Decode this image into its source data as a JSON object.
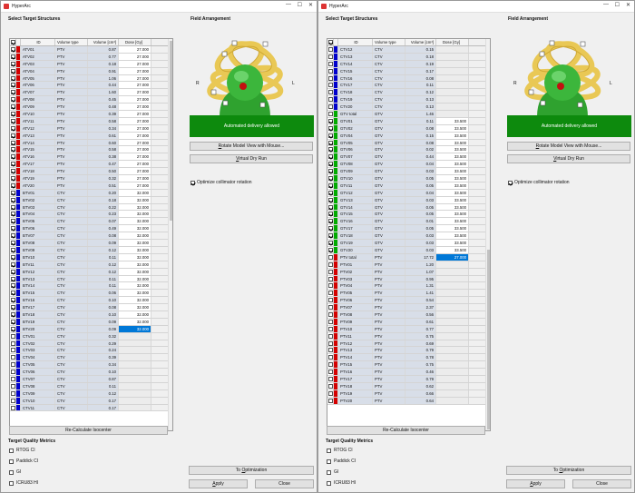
{
  "windows": [
    {
      "title": "HyperArc",
      "select_title": "Select Target Structures",
      "headers": {
        "id": "ID",
        "volume_type": "Volume type",
        "volume": "Volume [cm³]",
        "dose": "Dose [Gy]"
      },
      "rows": [
        {
          "c": 1,
          "color": "#d40000",
          "id": "ATV01",
          "vt": "PTV",
          "vol": "0.87",
          "dose": "27.000"
        },
        {
          "c": 1,
          "color": "#d40000",
          "id": "ATV02",
          "vt": "PTV",
          "vol": "0.77",
          "dose": "27.000"
        },
        {
          "c": 1,
          "color": "#d40000",
          "id": "ATV03",
          "vt": "PTV",
          "vol": "0.18",
          "dose": "27.000"
        },
        {
          "c": 1,
          "color": "#d40000",
          "id": "ATV04",
          "vt": "PTV",
          "vol": "0.91",
          "dose": "27.000"
        },
        {
          "c": 1,
          "color": "#d40000",
          "id": "ATV05",
          "vt": "PTV",
          "vol": "1.06",
          "dose": "27.000"
        },
        {
          "c": 1,
          "color": "#d40000",
          "id": "ATV06",
          "vt": "PTV",
          "vol": "0.44",
          "dose": "27.000"
        },
        {
          "c": 1,
          "color": "#d40000",
          "id": "ATV07",
          "vt": "PTV",
          "vol": "1.60",
          "dose": "27.000"
        },
        {
          "c": 1,
          "color": "#d40000",
          "id": "ATV08",
          "vt": "PTV",
          "vol": "0.45",
          "dose": "27.000"
        },
        {
          "c": 1,
          "color": "#d40000",
          "id": "ATV09",
          "vt": "PTV",
          "vol": "0.48",
          "dose": "27.000"
        },
        {
          "c": 1,
          "color": "#d40000",
          "id": "ATV10",
          "vt": "PTV",
          "vol": "0.39",
          "dose": "27.000"
        },
        {
          "c": 1,
          "color": "#d40000",
          "id": "ATV11",
          "vt": "PTV",
          "vol": "0.58",
          "dose": "27.000"
        },
        {
          "c": 1,
          "color": "#d40000",
          "id": "ATV12",
          "vt": "PTV",
          "vol": "0.34",
          "dose": "27.000"
        },
        {
          "c": 1,
          "color": "#d40000",
          "id": "ATV13",
          "vt": "PTV",
          "vol": "0.61",
          "dose": "27.000"
        },
        {
          "c": 1,
          "color": "#d40000",
          "id": "ATV14",
          "vt": "PTV",
          "vol": "0.60",
          "dose": "27.000"
        },
        {
          "c": 1,
          "color": "#d40000",
          "id": "ATV15",
          "vt": "PTV",
          "vol": "0.58",
          "dose": "27.000"
        },
        {
          "c": 1,
          "color": "#d40000",
          "id": "ATV16",
          "vt": "PTV",
          "vol": "0.38",
          "dose": "27.000"
        },
        {
          "c": 1,
          "color": "#d40000",
          "id": "ATV17",
          "vt": "PTV",
          "vol": "0.47",
          "dose": "27.000"
        },
        {
          "c": 1,
          "color": "#d40000",
          "id": "ATV18",
          "vt": "PTV",
          "vol": "0.50",
          "dose": "27.000"
        },
        {
          "c": 1,
          "color": "#d40000",
          "id": "ATV19",
          "vt": "PTV",
          "vol": "0.32",
          "dose": "27.000"
        },
        {
          "c": 1,
          "color": "#d40000",
          "id": "ATV20",
          "vt": "PTV",
          "vol": "0.51",
          "dose": "27.000"
        },
        {
          "c": 1,
          "color": "#0000cc",
          "id": "BTV01",
          "vt": "CTV",
          "vol": "0.20",
          "dose": "32.000"
        },
        {
          "c": 1,
          "color": "#0000cc",
          "id": "BTV02",
          "vt": "CTV",
          "vol": "0.18",
          "dose": "32.000"
        },
        {
          "c": 1,
          "color": "#0000cc",
          "id": "BTV03",
          "vt": "CTV",
          "vol": "0.22",
          "dose": "32.000"
        },
        {
          "c": 1,
          "color": "#0000cc",
          "id": "BTV04",
          "vt": "CTV",
          "vol": "0.23",
          "dose": "32.000"
        },
        {
          "c": 1,
          "color": "#0000cc",
          "id": "BTV05",
          "vt": "CTV",
          "vol": "0.07",
          "dose": "32.000"
        },
        {
          "c": 1,
          "color": "#0000cc",
          "id": "BTV06",
          "vt": "CTV",
          "vol": "0.49",
          "dose": "32.000"
        },
        {
          "c": 1,
          "color": "#0000cc",
          "id": "BTV07",
          "vt": "CTV",
          "vol": "0.08",
          "dose": "32.000"
        },
        {
          "c": 1,
          "color": "#0000cc",
          "id": "BTV08",
          "vt": "CTV",
          "vol": "0.09",
          "dose": "32.000"
        },
        {
          "c": 1,
          "color": "#0000cc",
          "id": "BTV09",
          "vt": "CTV",
          "vol": "0.12",
          "dose": "32.000"
        },
        {
          "c": 1,
          "color": "#0000cc",
          "id": "BTV10",
          "vt": "CTV",
          "vol": "0.11",
          "dose": "32.000"
        },
        {
          "c": 1,
          "color": "#0000cc",
          "id": "BTV11",
          "vt": "CTV",
          "vol": "0.12",
          "dose": "32.000"
        },
        {
          "c": 1,
          "color": "#0000cc",
          "id": "BTV12",
          "vt": "CTV",
          "vol": "0.12",
          "dose": "32.000"
        },
        {
          "c": 1,
          "color": "#0000cc",
          "id": "BTV13",
          "vt": "CTV",
          "vol": "0.11",
          "dose": "32.000"
        },
        {
          "c": 1,
          "color": "#0000cc",
          "id": "BTV14",
          "vt": "CTV",
          "vol": "0.11",
          "dose": "32.000"
        },
        {
          "c": 1,
          "color": "#0000cc",
          "id": "BTV15",
          "vt": "CTV",
          "vol": "0.06",
          "dose": "32.000"
        },
        {
          "c": 1,
          "color": "#0000cc",
          "id": "BTV16",
          "vt": "CTV",
          "vol": "0.10",
          "dose": "32.000"
        },
        {
          "c": 1,
          "color": "#0000cc",
          "id": "BTV17",
          "vt": "CTV",
          "vol": "0.08",
          "dose": "32.000"
        },
        {
          "c": 1,
          "color": "#0000cc",
          "id": "BTV18",
          "vt": "CTV",
          "vol": "0.10",
          "dose": "32.000"
        },
        {
          "c": 1,
          "color": "#0000cc",
          "id": "BTV19",
          "vt": "CTV",
          "vol": "0.09",
          "dose": "32.000"
        },
        {
          "c": 1,
          "color": "#0000cc",
          "id": "BTV20",
          "vt": "CTV",
          "vol": "0.09",
          "dose": "32.000",
          "sel": 1
        },
        {
          "c": 0,
          "color": "#0000cc",
          "id": "CTV01",
          "vt": "CTV",
          "vol": "0.32",
          "dose": ""
        },
        {
          "c": 0,
          "color": "#0000cc",
          "id": "CTV02",
          "vt": "CTV",
          "vol": "0.29",
          "dose": ""
        },
        {
          "c": 0,
          "color": "#0000cc",
          "id": "CTV03",
          "vt": "CTV",
          "vol": "0.24",
          "dose": ""
        },
        {
          "c": 0,
          "color": "#0000cc",
          "id": "CTV04",
          "vt": "CTV",
          "vol": "0.39",
          "dose": ""
        },
        {
          "c": 0,
          "color": "#0000cc",
          "id": "CTV05",
          "vt": "CTV",
          "vol": "0.34",
          "dose": ""
        },
        {
          "c": 0,
          "color": "#0000cc",
          "id": "CTV06",
          "vt": "CTV",
          "vol": "0.10",
          "dose": ""
        },
        {
          "c": 0,
          "color": "#0000cc",
          "id": "CTV07",
          "vt": "CTV",
          "vol": "0.87",
          "dose": ""
        },
        {
          "c": 0,
          "color": "#0000cc",
          "id": "CTV08",
          "vt": "CTV",
          "vol": "0.11",
          "dose": ""
        },
        {
          "c": 0,
          "color": "#0000cc",
          "id": "CTV09",
          "vt": "CTV",
          "vol": "0.12",
          "dose": ""
        },
        {
          "c": 0,
          "color": "#0000cc",
          "id": "CTV10",
          "vt": "CTV",
          "vol": "0.17",
          "dose": ""
        },
        {
          "c": 0,
          "color": "#0000cc",
          "id": "CTV11",
          "vt": "CTV",
          "vol": "0.17",
          "dose": ""
        }
      ],
      "recalc": "Re-Calculate Isocenter",
      "quality_title": "Target Quality Metrics",
      "metrics": [
        "RTOG CI",
        "Paddick CI",
        "GI",
        "ICRU83 HI"
      ],
      "field_title": "Field Arrangement",
      "status": "Automated delivery allowed",
      "status_color": "#0d8a0d",
      "rotate": "Rotate Model View with Mouse...",
      "virtual": "Virtual Dry Run",
      "optimize": "Optimize collimator rotation",
      "to_opt": "To Optimization",
      "apply": "Apply",
      "close": "Close",
      "lbl_r": "R",
      "lbl_l": "L"
    },
    {
      "title": "HyperArc",
      "select_title": "Select Target Structures",
      "headers": {
        "id": "ID",
        "volume_type": "Volume type",
        "volume": "Volume [cm³]",
        "dose": "Dose [Gy]"
      },
      "rows": [
        {
          "c": 0,
          "color": "#0000cc",
          "id": "CTV12",
          "vt": "CTV",
          "vol": "0.15",
          "dose": ""
        },
        {
          "c": 0,
          "color": "#0000cc",
          "id": "CTV13",
          "vt": "CTV",
          "vol": "0.18",
          "dose": ""
        },
        {
          "c": 0,
          "color": "#0000cc",
          "id": "CTV14",
          "vt": "CTV",
          "vol": "0.19",
          "dose": ""
        },
        {
          "c": 0,
          "color": "#0000cc",
          "id": "CTV15",
          "vt": "CTV",
          "vol": "0.17",
          "dose": ""
        },
        {
          "c": 0,
          "color": "#0000cc",
          "id": "CTV16",
          "vt": "CTV",
          "vol": "0.08",
          "dose": ""
        },
        {
          "c": 0,
          "color": "#0000cc",
          "id": "CTV17",
          "vt": "CTV",
          "vol": "0.11",
          "dose": ""
        },
        {
          "c": 0,
          "color": "#0000cc",
          "id": "CTV18",
          "vt": "CTV",
          "vol": "0.12",
          "dose": ""
        },
        {
          "c": 0,
          "color": "#0000cc",
          "id": "CTV19",
          "vt": "CTV",
          "vol": "0.13",
          "dose": ""
        },
        {
          "c": 0,
          "color": "#0000cc",
          "id": "CTV20",
          "vt": "CTV",
          "vol": "0.13",
          "dose": ""
        },
        {
          "c": 0,
          "color": "#00aa00",
          "id": "GTV total",
          "vt": "GTV",
          "vol": "1.46",
          "dose": ""
        },
        {
          "c": 1,
          "color": "#00aa00",
          "id": "GTV01",
          "vt": "GTV",
          "vol": "0.11",
          "dose": "33.500"
        },
        {
          "c": 1,
          "color": "#00aa00",
          "id": "GTV02",
          "vt": "GTV",
          "vol": "0.08",
          "dose": "33.500"
        },
        {
          "c": 1,
          "color": "#00aa00",
          "id": "GTV04",
          "vt": "GTV",
          "vol": "0.15",
          "dose": "33.500"
        },
        {
          "c": 1,
          "color": "#00aa00",
          "id": "GTV05",
          "vt": "GTV",
          "vol": "0.08",
          "dose": "33.500"
        },
        {
          "c": 1,
          "color": "#00aa00",
          "id": "GTV06",
          "vt": "GTV",
          "vol": "0.02",
          "dose": "33.500"
        },
        {
          "c": 1,
          "color": "#00aa00",
          "id": "GTV07",
          "vt": "GTV",
          "vol": "0.44",
          "dose": "33.500"
        },
        {
          "c": 1,
          "color": "#00aa00",
          "id": "GTV08",
          "vt": "GTV",
          "vol": "0.04",
          "dose": "33.500"
        },
        {
          "c": 1,
          "color": "#00aa00",
          "id": "GTV09",
          "vt": "GTV",
          "vol": "0.03",
          "dose": "33.500"
        },
        {
          "c": 1,
          "color": "#00aa00",
          "id": "GTV10",
          "vt": "GTV",
          "vol": "0.05",
          "dose": "33.500"
        },
        {
          "c": 1,
          "color": "#00aa00",
          "id": "GTV11",
          "vt": "GTV",
          "vol": "0.05",
          "dose": "33.500"
        },
        {
          "c": 1,
          "color": "#00aa00",
          "id": "GTV12",
          "vt": "GTV",
          "vol": "0.04",
          "dose": "33.500"
        },
        {
          "c": 1,
          "color": "#00aa00",
          "id": "GTV13",
          "vt": "GTV",
          "vol": "0.03",
          "dose": "33.500"
        },
        {
          "c": 1,
          "color": "#00aa00",
          "id": "GTV14",
          "vt": "GTV",
          "vol": "0.05",
          "dose": "33.500"
        },
        {
          "c": 1,
          "color": "#00aa00",
          "id": "GTV15",
          "vt": "GTV",
          "vol": "0.05",
          "dose": "33.500"
        },
        {
          "c": 1,
          "color": "#00aa00",
          "id": "GTV16",
          "vt": "GTV",
          "vol": "0.01",
          "dose": "33.500"
        },
        {
          "c": 1,
          "color": "#00aa00",
          "id": "GTV17",
          "vt": "GTV",
          "vol": "0.05",
          "dose": "33.500"
        },
        {
          "c": 1,
          "color": "#00aa00",
          "id": "GTV18",
          "vt": "GTV",
          "vol": "0.03",
          "dose": "33.500"
        },
        {
          "c": 1,
          "color": "#00aa00",
          "id": "GTV19",
          "vt": "GTV",
          "vol": "0.03",
          "dose": "33.500"
        },
        {
          "c": 1,
          "color": "#00aa00",
          "id": "GTV20",
          "vt": "GTV",
          "vol": "0.03",
          "dose": "33.500"
        },
        {
          "c": 0,
          "color": "#d40000",
          "id": "PTV total",
          "vt": "PTV",
          "vol": "17.72",
          "dose": "27.000",
          "sel": 1
        },
        {
          "c": 0,
          "color": "#d40000",
          "id": "PTV01",
          "vt": "PTV",
          "vol": "1.20",
          "dose": ""
        },
        {
          "c": 0,
          "color": "#d40000",
          "id": "PTV02",
          "vt": "PTV",
          "vol": "1.07",
          "dose": ""
        },
        {
          "c": 0,
          "color": "#d40000",
          "id": "PTV03",
          "vt": "PTV",
          "vol": "0.95",
          "dose": ""
        },
        {
          "c": 0,
          "color": "#d40000",
          "id": "PTV04",
          "vt": "PTV",
          "vol": "1.31",
          "dose": ""
        },
        {
          "c": 0,
          "color": "#d40000",
          "id": "PTV05",
          "vt": "PTV",
          "vol": "1.41",
          "dose": ""
        },
        {
          "c": 0,
          "color": "#d40000",
          "id": "PTV06",
          "vt": "PTV",
          "vol": "0.54",
          "dose": ""
        },
        {
          "c": 0,
          "color": "#d40000",
          "id": "PTV07",
          "vt": "PTV",
          "vol": "2.37",
          "dose": ""
        },
        {
          "c": 0,
          "color": "#d40000",
          "id": "PTV08",
          "vt": "PTV",
          "vol": "0.56",
          "dose": ""
        },
        {
          "c": 0,
          "color": "#d40000",
          "id": "PTV09",
          "vt": "PTV",
          "vol": "0.61",
          "dose": ""
        },
        {
          "c": 0,
          "color": "#d40000",
          "id": "PTV10",
          "vt": "PTV",
          "vol": "0.77",
          "dose": ""
        },
        {
          "c": 0,
          "color": "#d40000",
          "id": "PTV11",
          "vt": "PTV",
          "vol": "0.75",
          "dose": ""
        },
        {
          "c": 0,
          "color": "#d40000",
          "id": "PTV12",
          "vt": "PTV",
          "vol": "0.69",
          "dose": ""
        },
        {
          "c": 0,
          "color": "#d40000",
          "id": "PTV13",
          "vt": "PTV",
          "vol": "0.79",
          "dose": ""
        },
        {
          "c": 0,
          "color": "#d40000",
          "id": "PTV14",
          "vt": "PTV",
          "vol": "0.78",
          "dose": ""
        },
        {
          "c": 0,
          "color": "#d40000",
          "id": "PTV15",
          "vt": "PTV",
          "vol": "0.75",
          "dose": ""
        },
        {
          "c": 0,
          "color": "#d40000",
          "id": "PTV16",
          "vt": "PTV",
          "vol": "0.46",
          "dose": ""
        },
        {
          "c": 0,
          "color": "#d40000",
          "id": "PTV17",
          "vt": "PTV",
          "vol": "0.79",
          "dose": ""
        },
        {
          "c": 0,
          "color": "#d40000",
          "id": "PTV18",
          "vt": "PTV",
          "vol": "0.62",
          "dose": ""
        },
        {
          "c": 0,
          "color": "#d40000",
          "id": "PTV19",
          "vt": "PTV",
          "vol": "0.66",
          "dose": ""
        },
        {
          "c": 0,
          "color": "#d40000",
          "id": "PTV20",
          "vt": "PTV",
          "vol": "0.64",
          "dose": ""
        }
      ],
      "recalc": "Re-Calculate Isocenter",
      "quality_title": "Target Quality Metrics",
      "metrics": [
        "RTOG CI",
        "Paddick CI",
        "GI",
        "ICRU83 HI"
      ],
      "field_title": "Field Arrangement",
      "status": "Automated delivery allowed",
      "status_color": "#0d8a0d",
      "rotate": "Rotate Model View with Mouse...",
      "virtual": "Virtual Dry Run",
      "optimize": "Optimize collimator rotation",
      "to_opt": "To Optimization",
      "apply": "Apply",
      "close": "Close",
      "lbl_r": "R",
      "lbl_l": "L"
    }
  ]
}
